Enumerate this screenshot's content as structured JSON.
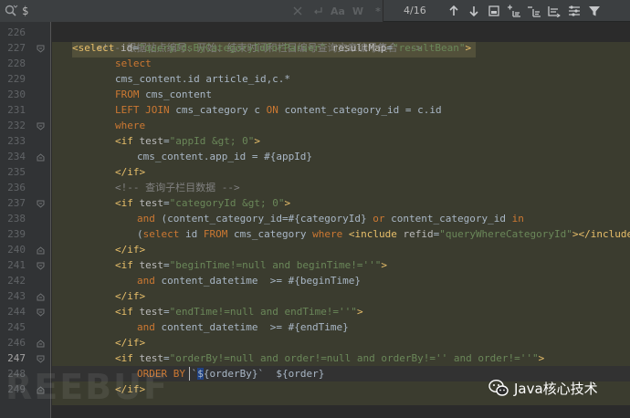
{
  "search": {
    "value": "$",
    "match_count": "4/16",
    "case_label": "Aa",
    "word_label": "W",
    "regex_label": "*"
  },
  "toolbar": {
    "icons": [
      "arrow-up-icon",
      "arrow-down-icon",
      "select-all-icon",
      "add-selection-icon",
      "remove-selection-icon",
      "select-all-occurrences-icon",
      "settings-icon",
      "filter-icon"
    ]
  },
  "gutter": {
    "line_numbers": [
      "226",
      "227",
      "228",
      "229",
      "230",
      "231",
      "232",
      "233",
      "234",
      "235",
      "236",
      "237",
      "238",
      "239",
      "240",
      "241",
      "242",
      "243",
      "244",
      "245",
      "246",
      "247",
      "248",
      "249"
    ],
    "current_line": "247"
  },
  "code": {
    "l226": {
      "comment": "<!-- 根据站点编号、开始、结束时间和栏目编号查询文章编号集合 -->"
    },
    "l227": {
      "open": "<select ",
      "a1": "id",
      "eq1": "=",
      "v1": "\"queryIdsByCategoryIdForParser\"",
      "sp": " ",
      "a2": "resultMap",
      "eq2": "=",
      "v2": "\"resultBean\"",
      "close": ">"
    },
    "l228": {
      "kw": "select"
    },
    "l229": {
      "txt": "cms_content.id article_id,c.*"
    },
    "l230": {
      "kw": "FROM",
      "txt": " cms_content"
    },
    "l231": {
      "kw1": "LEFT JOIN",
      "txt1": " cms_category c ",
      "kw2": "ON",
      "txt2": " content_category_id = c.id"
    },
    "l232": {
      "kw": "where"
    },
    "l233": {
      "open": "<if ",
      "a": "test",
      "eq": "=",
      "v": "\"appId &gt; 0\"",
      "close": ">"
    },
    "l234": {
      "txt": "cms_content.app_id = #{appId}"
    },
    "l235": {
      "tag": "</if>"
    },
    "l236": {
      "comment": "<!-- 查询子栏目数据 -->"
    },
    "l237": {
      "open": "<if ",
      "a": "test",
      "eq": "=",
      "v": "\"categoryId &gt; 0\"",
      "close": ">"
    },
    "l238": {
      "kw1": "and",
      "txt1": " (content_category_id=#{categoryId} ",
      "kw2": "or",
      "txt2": " content_category_id ",
      "kw3": "in"
    },
    "l239": {
      "p1": "(",
      "kw1": "select",
      "t1": " id ",
      "kw2": "FROM",
      "t2": " cms_category ",
      "kw3": "where",
      "sp": " ",
      "inc_open": "<include ",
      "inc_attr": "refid",
      "inc_eq": "=",
      "inc_val": "\"queryWhereCategoryId\"",
      "inc_close": "></include>",
      "p2": "))"
    },
    "l240": {
      "tag": "</if>"
    },
    "l241": {
      "open": "<if ",
      "a": "test",
      "eq": "=",
      "v": "\"beginTime!=null and beginTime!=''\"",
      "close": ">"
    },
    "l242": {
      "kw": "and",
      "txt": " content_datetime  >= #{beginTime}"
    },
    "l243": {
      "tag": "</if>"
    },
    "l244": {
      "open": "<if ",
      "a": "test",
      "eq": "=",
      "v": "\"endTime!=null and endTime!=''\"",
      "close": ">"
    },
    "l245": {
      "kw": "and",
      "txt": " content_datetime  >= #{endTime}"
    },
    "l246": {
      "tag": "</if>"
    },
    "l247": {
      "open": "<if ",
      "a": "test",
      "eq": "=",
      "v": "\"orderBy!=null and order!=null and orderBy!='' and order!=''\"",
      "close": ">"
    },
    "l248": {
      "kw": "ORDER BY",
      "txt1": " `",
      "sel": "$",
      "txt2": "{orderBy}`  ${order}"
    },
    "l249": {
      "tag": "</if>"
    }
  },
  "watermark": {
    "label": "Java核心技术",
    "ghost": "REEBUF"
  },
  "colors": {
    "background": "#2b2b2b",
    "keyword": "#cc7832",
    "tag": "#e8bf6a",
    "string": "#6a8759",
    "comment": "#808080",
    "text": "#a9b7c6"
  }
}
